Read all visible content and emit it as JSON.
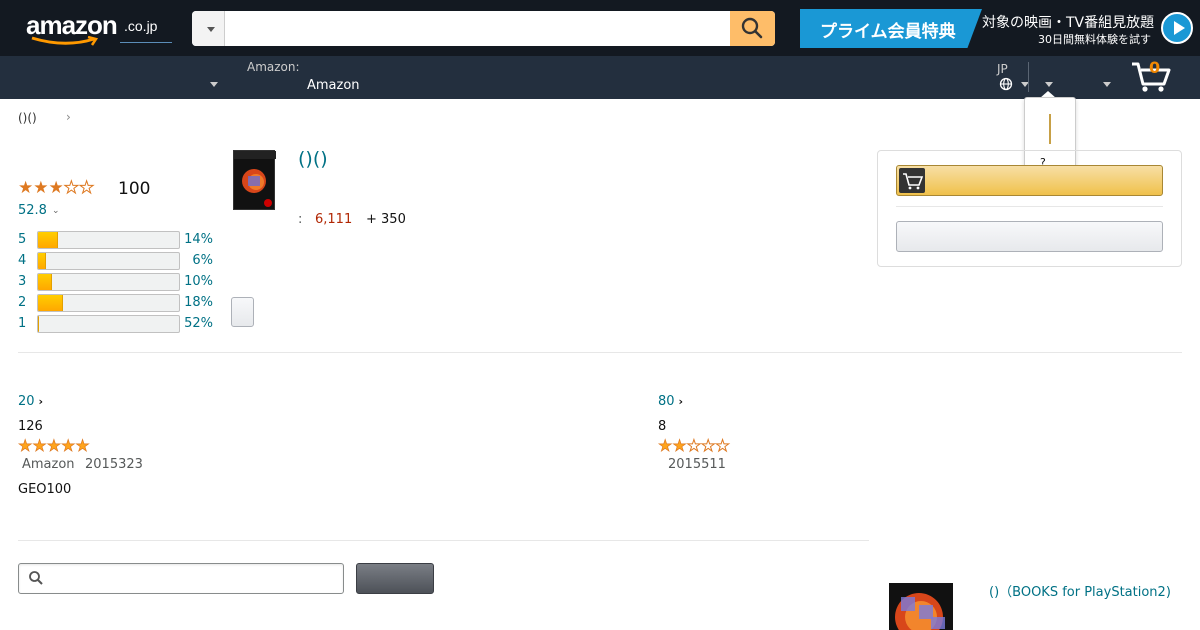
{
  "header": {
    "logo_text": "amazon",
    "logo_suffix": ".co.jp",
    "search": {
      "placeholder": "",
      "value": ""
    },
    "prime_banner": {
      "badge_text": "プライム会員特典",
      "headline": "対象の映画・TV番組見放題",
      "subline": "30日間無料体験を試す"
    },
    "deliver_label": "Amazon:",
    "deliver_value": "Amazon",
    "language": "JP",
    "cart_count": "0"
  },
  "popover": {
    "question_mark": "?"
  },
  "breadcrumb": {
    "item": "()()",
    "separator": "›"
  },
  "rating_summary": {
    "stars": 3,
    "count": "100",
    "percent_text": "52.8",
    "histogram": [
      {
        "star": "5",
        "percent": 14,
        "percent_text": "14%"
      },
      {
        "star": "4",
        "percent": 6,
        "percent_text": "6%"
      },
      {
        "star": "3",
        "percent": 10,
        "percent_text": "10%"
      },
      {
        "star": "2",
        "percent": 18,
        "percent_text": "18%"
      },
      {
        "star": "1",
        "percent": 52,
        "percent_text": "52%"
      }
    ]
  },
  "product": {
    "title": "()()",
    "price_label": ":",
    "price": "6,111",
    "price_extra": "+ 350"
  },
  "reviews": [
    {
      "helpful_link": "20",
      "title": "126",
      "stars": 5,
      "author": "Amazon",
      "date": "2015323",
      "body": "GEO100"
    },
    {
      "helpful_link": "80",
      "title": "8",
      "stars": 2,
      "author": "",
      "date": "2015511",
      "body": ""
    }
  ],
  "review_search": {
    "placeholder": ""
  },
  "side_product": {
    "title": "()（BOOKS for PlayStation2)"
  }
}
